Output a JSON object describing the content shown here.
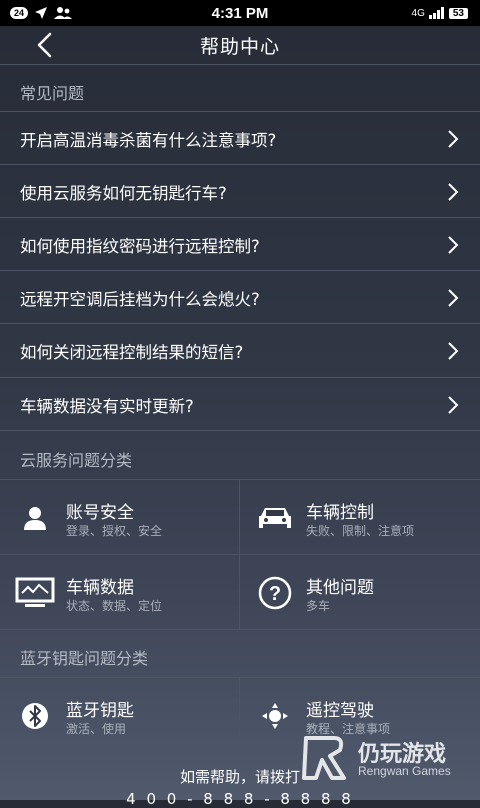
{
  "status": {
    "notification_count": "24",
    "time": "4:31 PM",
    "network": "4G",
    "battery": "53"
  },
  "header": {
    "title": "帮助中心"
  },
  "faq": {
    "section_title": "常见问题",
    "items": [
      "开启高温消毒杀菌有什么注意事项?",
      "使用云服务如何无钥匙行车?",
      "如何使用指纹密码进行远程控制?",
      "远程开空调后挂档为什么会熄火?",
      "如何关闭远程控制结果的短信?",
      "车辆数据没有实时更新?"
    ]
  },
  "cloud": {
    "section_title": "云服务问题分类",
    "categories": [
      {
        "title": "账号安全",
        "subtitle": "登录、授权、安全",
        "icon": "user-icon"
      },
      {
        "title": "车辆控制",
        "subtitle": "失败、限制、注意项",
        "icon": "car-icon"
      },
      {
        "title": "车辆数据",
        "subtitle": "状态、数据、定位",
        "icon": "monitor-icon"
      },
      {
        "title": "其他问题",
        "subtitle": "多车",
        "icon": "question-icon"
      }
    ]
  },
  "bluetooth": {
    "section_title": "蓝牙钥匙问题分类",
    "categories": [
      {
        "title": "蓝牙钥匙",
        "subtitle": "激活、使用",
        "icon": "bluetooth-icon"
      },
      {
        "title": "遥控驾驶",
        "subtitle": "教程、注意事项",
        "icon": "remote-drive-icon"
      }
    ]
  },
  "footer": {
    "text": "如需帮助，请拨打",
    "phone": "4 0 0 - 8 8 8 - 8 8 8 8"
  },
  "watermark": {
    "name": "仍玩游戏",
    "sub": "Rengwan Games"
  }
}
